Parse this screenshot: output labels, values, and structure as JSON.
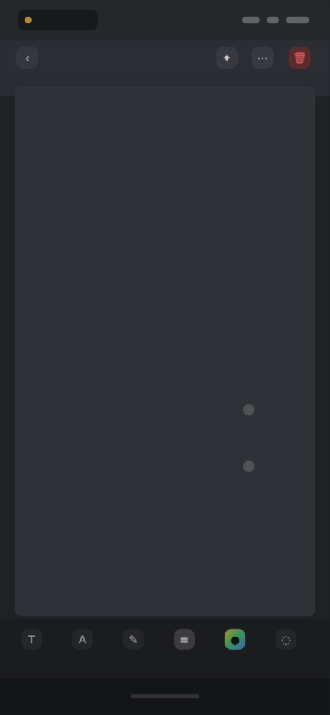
{
  "status_bar": {
    "time": "",
    "indicator_color": "#b58a3f"
  },
  "toolbar": {
    "back_icon": "back-arrow-icon",
    "title": "",
    "fx_icon": "effects-icon",
    "more_icon": "more-icon",
    "delete_icon": "delete-icon",
    "delete_color": "#ff6b6b"
  },
  "canvas": {
    "text": "",
    "background": "#2f3136"
  },
  "bottom_tools": [
    {
      "icon": "text-tool-icon",
      "label": ""
    },
    {
      "icon": "font-tool-icon",
      "label": ""
    },
    {
      "icon": "style-tool-icon",
      "label": ""
    },
    {
      "icon": "align-tool-icon",
      "label": ""
    },
    {
      "icon": "color-tool-icon",
      "label": ""
    },
    {
      "icon": "bubble-tool-icon",
      "label": ""
    }
  ]
}
